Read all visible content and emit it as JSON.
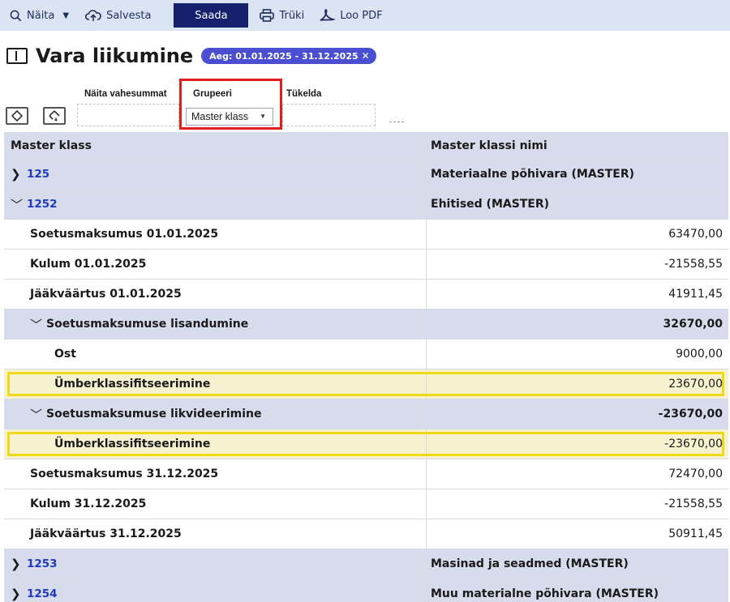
{
  "toolbar": {
    "naita": "Näita",
    "salvesta": "Salvesta",
    "saada": "Saada",
    "truki": "Trüki",
    "loo_pdf": "Loo PDF"
  },
  "title": "Vara liikumine",
  "period_badge": "Aeg: 01.01.2025 - 31.12.2025",
  "controls": {
    "subtotal_label": "Näita vahesummat",
    "group_label": "Grupeeri",
    "split_label": "Tükelda",
    "group_value": "Master klass"
  },
  "table": {
    "col_a": "Master klass",
    "col_b": "Master klassi nimi",
    "rows": [
      {
        "a": "125",
        "b": "Materiaalne põhivara (MASTER)"
      },
      {
        "a": "1252",
        "b": "Ehitised (MASTER)"
      },
      {
        "a": "Soetusmaksumus 01.01.2025",
        "b": "63470,00"
      },
      {
        "a": "Kulum 01.01.2025",
        "b": "-21558,55"
      },
      {
        "a": "Jääkväärtus 01.01.2025",
        "b": "41911,45"
      },
      {
        "a": "Soetusmaksumuse lisandumine",
        "b": "32670,00"
      },
      {
        "a": "Ost",
        "b": "9000,00"
      },
      {
        "a": "Ümberklassifitseerimine",
        "b": "23670,00"
      },
      {
        "a": "Soetusmaksumuse likvideerimine",
        "b": "-23670,00"
      },
      {
        "a": "Ümberklassifitseerimine",
        "b": "-23670,00"
      },
      {
        "a": "Soetusmaksumus 31.12.2025",
        "b": "72470,00"
      },
      {
        "a": "Kulum 31.12.2025",
        "b": "-21558,55"
      },
      {
        "a": "Jääkväärtus 31.12.2025",
        "b": "50911,45"
      },
      {
        "a": "1253",
        "b": "Masinad ja seadmed (MASTER)"
      },
      {
        "a": "1254",
        "b": "Muu materialne põhivara (MASTER)"
      }
    ]
  },
  "colors": {
    "toolbar_bg": "#dbe4f3",
    "accent": "#16216e",
    "badge": "#4a4fd1",
    "highlight_frame": "#f0d81a",
    "annotation_red": "#e11c1c"
  }
}
